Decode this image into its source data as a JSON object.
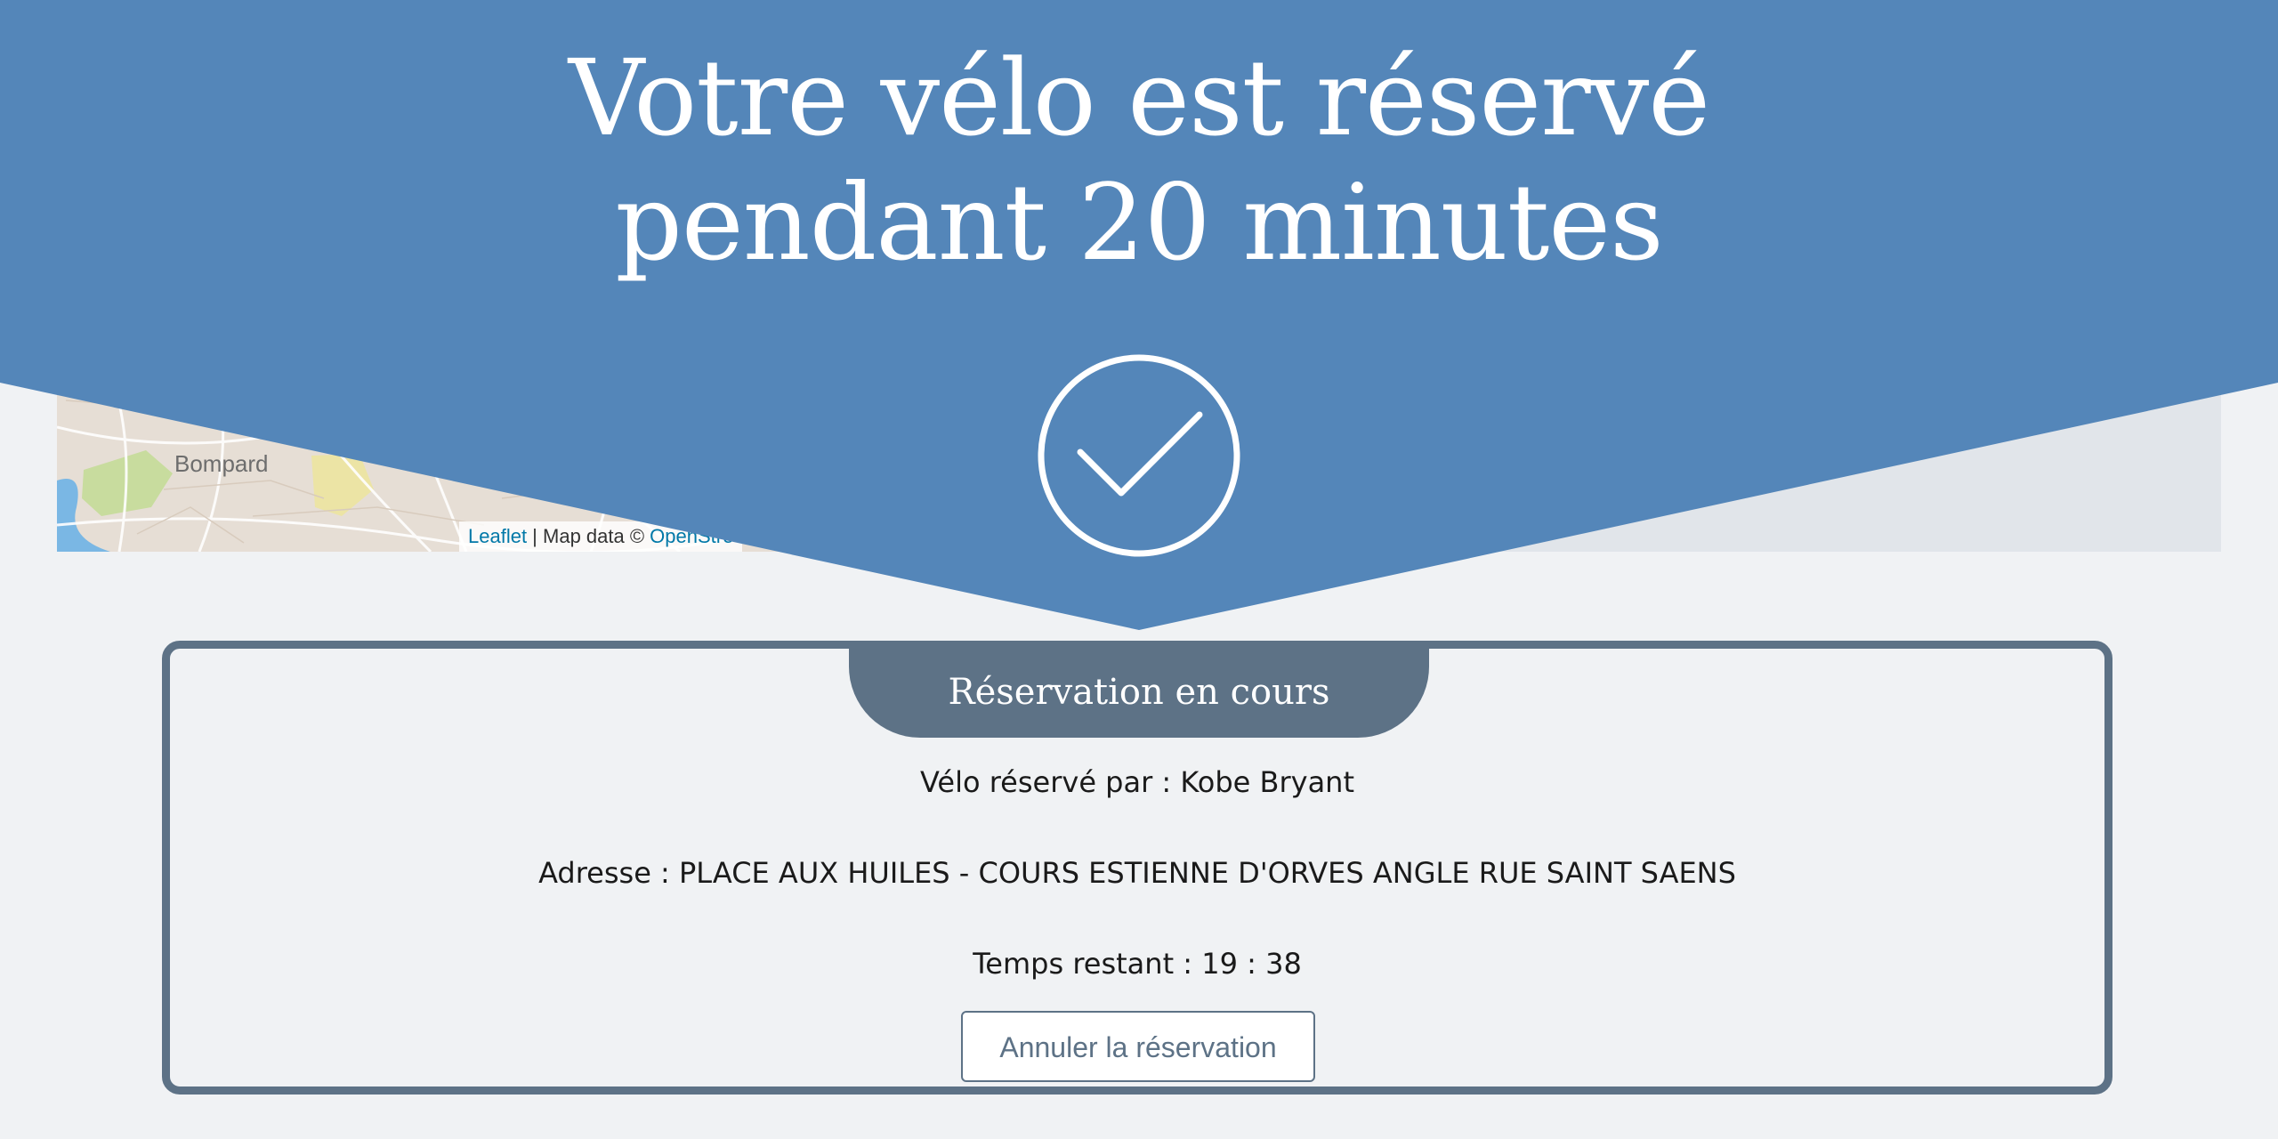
{
  "header": {
    "title_line1": "Votre vélo est réservé",
    "title_line2": "pendant 20 minutes",
    "check_icon": "checkmark-circle-icon",
    "banner_color": "#5486b9"
  },
  "map": {
    "place_label": "Bompard",
    "attribution_leaflet": "Leaflet",
    "attribution_separator": " | Map data © ",
    "attribution_osm": "OpenStre"
  },
  "reservation": {
    "tab_title": "Réservation en cours",
    "reserved_by": "Vélo réservé par : Kobe Bryant",
    "address": "Adresse : PLACE AUX HUILES - COURS ESTIENNE D'ORVES ANGLE RUE SAINT SAENS",
    "time_remaining": "Temps restant : 19 : 38",
    "cancel_label": "Annuler la réservation",
    "accent_color": "#5d7286"
  }
}
